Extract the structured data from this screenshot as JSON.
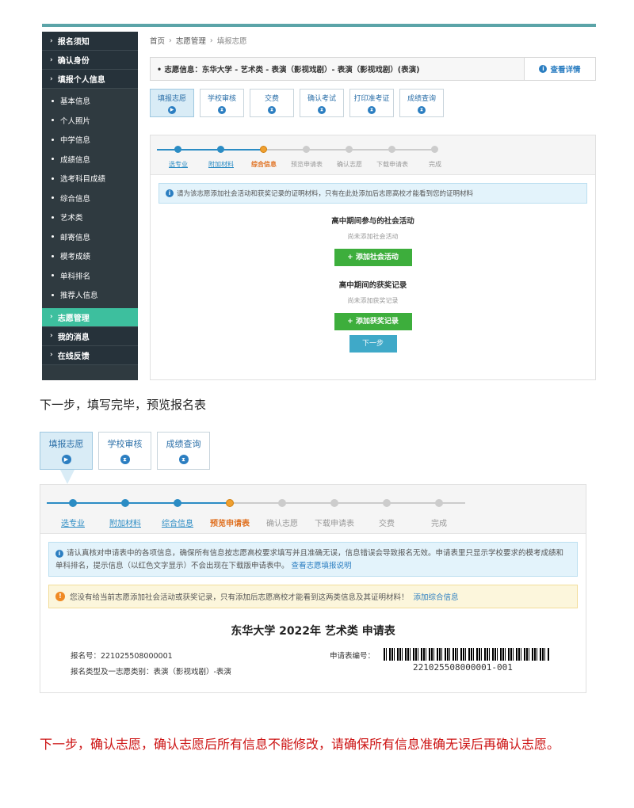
{
  "shot1": {
    "sidebar": {
      "sections_top": [
        "报名须知",
        "确认身份",
        "填报个人信息"
      ],
      "items": [
        "基本信息",
        "个人照片",
        "中学信息",
        "成绩信息",
        "选考科目成绩",
        "综合信息",
        "艺术类",
        "邮寄信息",
        "模考成绩",
        "单科排名",
        "推荐人信息"
      ],
      "sections_bottom": [
        "志愿管理",
        "我的消息",
        "在线反馈"
      ]
    },
    "breadcrumb": [
      "首页",
      "志愿管理",
      "填报志愿"
    ],
    "info_bar": {
      "text": "志愿信息：东华大学 - 艺术类 - 表演（影视戏剧）- 表演（影视戏剧）(表演)",
      "detail": "查看详情"
    },
    "tabs": [
      "填报志愿",
      "学校审核",
      "交费",
      "确认考试",
      "打印准考证",
      "成绩查询"
    ],
    "steps": [
      "选专业",
      "附加材料",
      "综合信息",
      "预览申请表",
      "确认志愿",
      "下载申请表",
      "完成"
    ],
    "notice": "请为该志愿添加社会活动和获奖记录的证明材料，只有在此处添加后志愿高校才能看到您的证明材料",
    "section_activity": {
      "title": "高中期间参与的社会活动",
      "empty": "尚未添加社会活动",
      "button": "+ 添加社会活动"
    },
    "section_award": {
      "title": "高中期间的获奖记录",
      "empty": "尚未添加获奖记录",
      "button": "+ 添加获奖记录"
    },
    "next_button": "下一步"
  },
  "caption1": "下一步，填写完毕，预览报名表",
  "shot2": {
    "tabs": [
      "填报志愿",
      "学校审核",
      "成绩查询"
    ],
    "steps": [
      "选专业",
      "附加材料",
      "综合信息",
      "预览申请表",
      "确认志愿",
      "下载申请表",
      "交费",
      "完成"
    ],
    "notice_text": "请认真核对申请表中的各项信息，确保所有信息按志愿高校要求填写并且准确无误，信息错误会导致报名无效。申请表里只显示学校要求的模考成绩和单科排名，提示信息（以红色文字显示）不会出现在下载版申请表中。",
    "notice_link": "查看志愿填报说明",
    "warn_text": "您没有给当前志愿添加社会活动或获奖记录，只有添加后志愿高校才能看到这两类信息及其证明材料！",
    "warn_link": "添加综合信息",
    "form_title": "东华大学 2022年 艺术类 申请表",
    "reg_no_label": "报名号：",
    "reg_no": "221025508000001",
    "form_no_label": "申请表编号：",
    "form_no": "221025508000001-001",
    "type_line": "报名类型及一志愿类别：表演（影视戏剧）-表演"
  },
  "caption2": "下一步，确认志愿，确认志愿后所有信息不能修改，请确保所有信息准确无误后再确认志愿。"
}
